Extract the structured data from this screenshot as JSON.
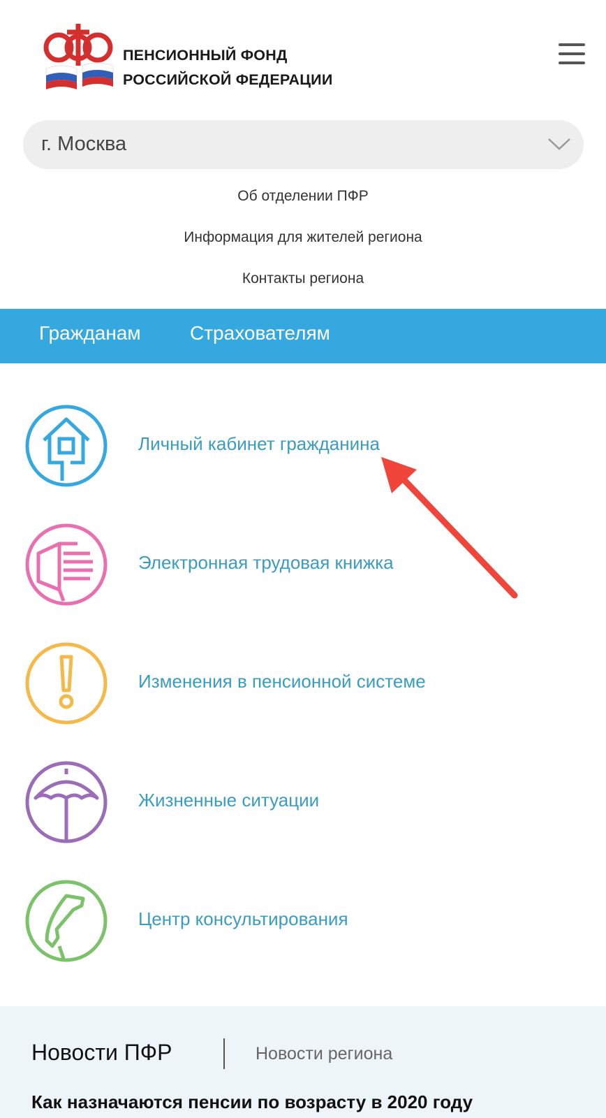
{
  "header": {
    "logo_line1": "ПЕНСИОННЫЙ ФОНД",
    "logo_line2": "РОССИЙСКОЙ ФЕДЕРАЦИИ",
    "logo_icon": "pfr-logo",
    "menu_icon": "hamburger-menu-icon"
  },
  "region": {
    "selected": "г. Москва",
    "icon": "chevron-down-icon"
  },
  "sublinks": [
    "Об отделении  ПФР",
    "Информация для жителей региона",
    "Контакты региона"
  ],
  "navbar": {
    "color": "#35a8e0",
    "items": [
      "Гражданам",
      "Страхователям"
    ]
  },
  "services": [
    {
      "label": "Личный кабинет гражданина",
      "icon": "house-icon",
      "color": "#35a8e0"
    },
    {
      "label": "Электронная трудовая книжка",
      "icon": "book-icon",
      "color": "#e96fb0"
    },
    {
      "label": "Изменения в пенсионной системе",
      "icon": "exclamation-icon",
      "color": "#f5b94a"
    },
    {
      "label": "Жизненные ситуации",
      "icon": "umbrella-icon",
      "color": "#9b6cb8"
    },
    {
      "label": "Центр консультирования",
      "icon": "phone-icon",
      "color": "#7cc26a"
    }
  ],
  "annotation": {
    "arrow_color": "#f0453a"
  },
  "news": {
    "tab_main": "Новости ПФР",
    "tab_region": "Новости региона",
    "headline": "Как назначаются пенсии по возрасту в 2020 году"
  }
}
